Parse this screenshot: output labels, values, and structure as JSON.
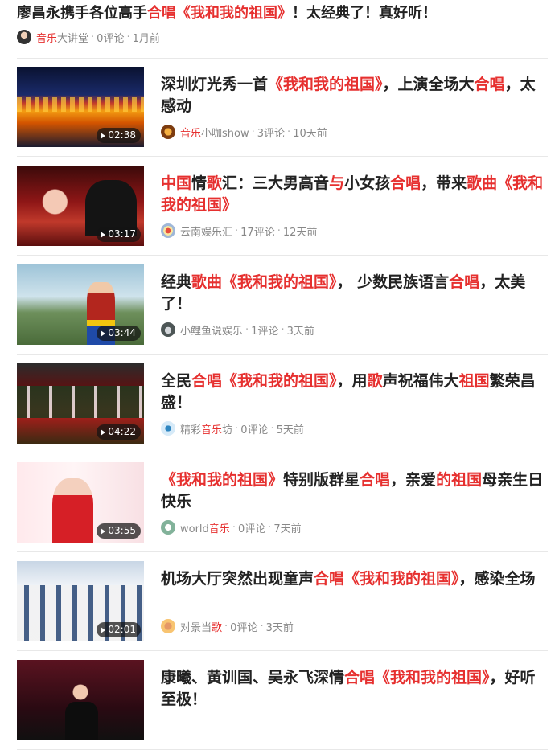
{
  "top_item": {
    "title_segments": [
      {
        "text": "廖昌永携手各位高手",
        "hl": false
      },
      {
        "text": "合唱",
        "hl": true
      },
      {
        "text": "《我和我的祖国》",
        "hl": true
      },
      {
        "text": "！太经典了！真好听！",
        "hl": false
      }
    ],
    "avatar_icon": "singer-avatar-icon",
    "source_segments": [
      {
        "text": "音乐",
        "hl": true
      },
      {
        "text": "大讲堂",
        "hl": false
      }
    ],
    "comments": "0评论",
    "time": "1月前"
  },
  "items": [
    {
      "thumb": "a1",
      "duration": "02:38",
      "title_segments": [
        {
          "text": "深圳灯光秀一首",
          "hl": false
        },
        {
          "text": "《我和我的祖国》",
          "hl": true
        },
        {
          "text": "，上演全场大",
          "hl": false
        },
        {
          "text": "合唱",
          "hl": true
        },
        {
          "text": "，太感动",
          "hl": false
        }
      ],
      "avatar": "av1",
      "source_segments": [
        {
          "text": "音乐",
          "hl": true
        },
        {
          "text": "小咖show",
          "hl": false
        }
      ],
      "comments": "3评论",
      "time": "10天前"
    },
    {
      "thumb": "a2",
      "duration": "03:17",
      "title_segments": [
        {
          "text": "中国",
          "hl": true
        },
        {
          "text": "情",
          "hl": false
        },
        {
          "text": "歌",
          "hl": true
        },
        {
          "text": "汇：三大男高音",
          "hl": false
        },
        {
          "text": "与",
          "hl": true
        },
        {
          "text": "小女孩",
          "hl": false
        },
        {
          "text": "合唱",
          "hl": true
        },
        {
          "text": "，带来",
          "hl": false
        },
        {
          "text": "歌曲",
          "hl": true
        },
        {
          "text": "《我和我的祖国》",
          "hl": true
        }
      ],
      "avatar": "av2",
      "source_segments": [
        {
          "text": "云南娱乐汇",
          "hl": false
        }
      ],
      "comments": "17评论",
      "time": "12天前"
    },
    {
      "thumb": "a3",
      "duration": "03:44",
      "title_segments": [
        {
          "text": "经典",
          "hl": false
        },
        {
          "text": "歌曲",
          "hl": true
        },
        {
          "text": "《我和我的祖国》",
          "hl": true
        },
        {
          "text": "， 少数民族语言",
          "hl": false
        },
        {
          "text": "合唱",
          "hl": true
        },
        {
          "text": "，太美了！",
          "hl": false
        }
      ],
      "avatar": "av3",
      "source_segments": [
        {
          "text": "小鲤鱼说娱乐",
          "hl": false
        }
      ],
      "comments": "1评论",
      "time": "3天前"
    },
    {
      "thumb": "a4",
      "duration": "04:22",
      "title_segments": [
        {
          "text": "全民",
          "hl": false
        },
        {
          "text": "合唱",
          "hl": true
        },
        {
          "text": "《我和我的祖国》",
          "hl": true
        },
        {
          "text": "，用",
          "hl": false
        },
        {
          "text": "歌",
          "hl": true
        },
        {
          "text": "声祝福伟大",
          "hl": false
        },
        {
          "text": "祖国",
          "hl": true
        },
        {
          "text": "繁荣昌盛！",
          "hl": false
        }
      ],
      "avatar": "av4",
      "source_segments": [
        {
          "text": "精彩",
          "hl": false
        },
        {
          "text": "音乐",
          "hl": true
        },
        {
          "text": "坊",
          "hl": false
        }
      ],
      "comments": "0评论",
      "time": "5天前"
    },
    {
      "thumb": "a5",
      "duration": "03:55",
      "title_segments": [
        {
          "text": "《我和我的祖国》",
          "hl": true
        },
        {
          "text": "特别版群星",
          "hl": false
        },
        {
          "text": "合唱",
          "hl": true
        },
        {
          "text": "，亲爱",
          "hl": false
        },
        {
          "text": "的祖国",
          "hl": true
        },
        {
          "text": "母亲生日快乐",
          "hl": false
        }
      ],
      "avatar": "av5",
      "source_segments": [
        {
          "text": "world",
          "hl": false
        },
        {
          "text": "音乐",
          "hl": true
        }
      ],
      "comments": "0评论",
      "time": "7天前"
    },
    {
      "thumb": "a6",
      "duration": "02:01",
      "title_segments": [
        {
          "text": "机场大厅突然出现童声",
          "hl": false
        },
        {
          "text": "合唱",
          "hl": true
        },
        {
          "text": "《我和我的祖国》",
          "hl": true
        },
        {
          "text": "，感染全场",
          "hl": false
        }
      ],
      "avatar": "av6",
      "source_segments": [
        {
          "text": "对景当",
          "hl": false
        },
        {
          "text": "歌",
          "hl": true
        }
      ],
      "comments": "0评论",
      "time": "3天前"
    },
    {
      "thumb": "a7",
      "duration": "",
      "title_segments": [
        {
          "text": "康曦、黄训国、吴永飞深情",
          "hl": false
        },
        {
          "text": "合唱",
          "hl": true
        },
        {
          "text": "《我和我的祖国》",
          "hl": true
        },
        {
          "text": "，好听至极！",
          "hl": false
        }
      ],
      "avatar": "",
      "source_segments": [],
      "comments": "",
      "time": ""
    }
  ]
}
